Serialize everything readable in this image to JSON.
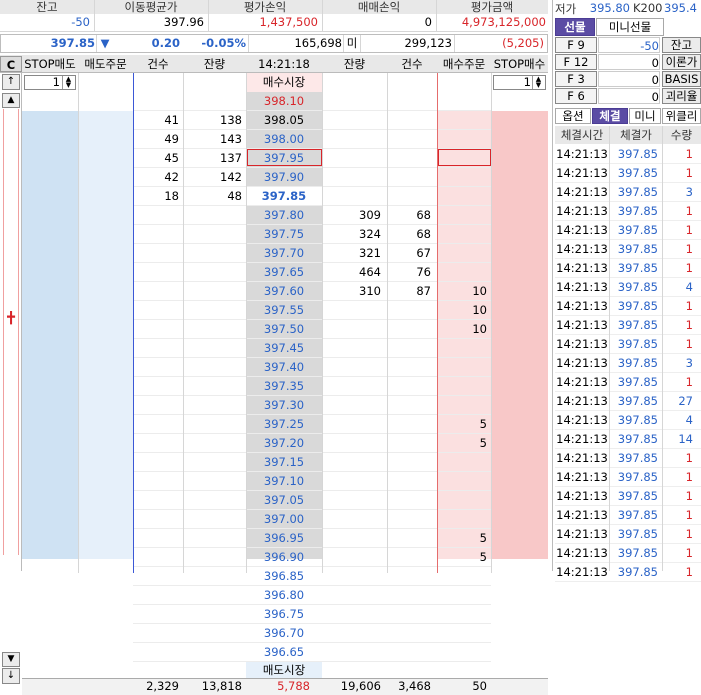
{
  "summary": {
    "headers": [
      "잔고",
      "이동평균가",
      "평가손익",
      "매매손익",
      "평가금액"
    ],
    "values": [
      "-50",
      "397.96",
      "1,437,500",
      "0",
      "4,973,125,000"
    ]
  },
  "quote": {
    "price": "397.85",
    "arrow": "▼",
    "change": "0.20",
    "rate": "-0.05%",
    "ask_total": "165,698",
    "label": "미",
    "bid_total": "299,123",
    "diff": "(5,205)"
  },
  "right_top": {
    "low_label": "저가",
    "low_value": "395.80",
    "k200_label": "K200",
    "k200_value": "395.4"
  },
  "tabs_top": [
    "선물",
    "미니선물"
  ],
  "fkeys": [
    {
      "key": "F 9",
      "value": "-50",
      "button": "잔고"
    },
    {
      "key": "F 12",
      "value": "0",
      "button": "이론가"
    },
    {
      "key": "F 3",
      "value": "0",
      "button": "BASIS"
    },
    {
      "key": "F 6",
      "value": "0",
      "button": "괴리율"
    }
  ],
  "tabs_bottom": [
    "옵션",
    "체결",
    "미니",
    "위클리"
  ],
  "ticks": {
    "headers": [
      "체결시간",
      "체결가",
      "수량"
    ],
    "rows": [
      {
        "time": "14:21:13",
        "price": "397.85",
        "qty": "1"
      },
      {
        "time": "14:21:13",
        "price": "397.85",
        "qty": "1"
      },
      {
        "time": "14:21:13",
        "price": "397.85",
        "qty": "3"
      },
      {
        "time": "14:21:13",
        "price": "397.85",
        "qty": "1"
      },
      {
        "time": "14:21:13",
        "price": "397.85",
        "qty": "1"
      },
      {
        "time": "14:21:13",
        "price": "397.85",
        "qty": "1"
      },
      {
        "time": "14:21:13",
        "price": "397.85",
        "qty": "1"
      },
      {
        "time": "14:21:13",
        "price": "397.85",
        "qty": "4"
      },
      {
        "time": "14:21:13",
        "price": "397.85",
        "qty": "1"
      },
      {
        "time": "14:21:13",
        "price": "397.85",
        "qty": "1"
      },
      {
        "time": "14:21:13",
        "price": "397.85",
        "qty": "1"
      },
      {
        "time": "14:21:13",
        "price": "397.85",
        "qty": "3"
      },
      {
        "time": "14:21:13",
        "price": "397.85",
        "qty": "1"
      },
      {
        "time": "14:21:13",
        "price": "397.85",
        "qty": "27"
      },
      {
        "time": "14:21:13",
        "price": "397.85",
        "qty": "4"
      },
      {
        "time": "14:21:13",
        "price": "397.85",
        "qty": "14"
      },
      {
        "time": "14:21:13",
        "price": "397.85",
        "qty": "1"
      },
      {
        "time": "14:21:13",
        "price": "397.85",
        "qty": "1"
      },
      {
        "time": "14:21:13",
        "price": "397.85",
        "qty": "1"
      },
      {
        "time": "14:21:13",
        "price": "397.85",
        "qty": "1"
      },
      {
        "time": "14:21:13",
        "price": "397.85",
        "qty": "1"
      },
      {
        "time": "14:21:13",
        "price": "397.85",
        "qty": "1"
      },
      {
        "time": "14:21:13",
        "price": "397.85",
        "qty": "1"
      }
    ]
  },
  "book": {
    "headers": [
      "C",
      "STOP매도",
      "매도주문",
      "건수",
      "잔량",
      "14:21:18",
      "잔량",
      "건수",
      "매수주문",
      "STOP매수"
    ],
    "stop_sell_qty": "1",
    "stop_buy_qty": "1",
    "market_sell": "매수시장",
    "market_buy": "매도시장",
    "rows": [
      {
        "price": "398.10",
        "c": "red",
        "ac": "",
        "aq": "",
        "bq": "",
        "bc": "",
        "bo": ""
      },
      {
        "price": "398.05",
        "c": "dk",
        "ac": "41",
        "aq": "138",
        "bq": "",
        "bc": "",
        "bo": ""
      },
      {
        "price": "398.00",
        "c": "blue",
        "ac": "49",
        "aq": "143",
        "bq": "",
        "bc": "",
        "bo": ""
      },
      {
        "price": "397.95",
        "c": "blue",
        "ac": "45",
        "aq": "137",
        "bq": "",
        "bc": "",
        "bo": ""
      },
      {
        "price": "397.90",
        "c": "blue",
        "ac": "42",
        "aq": "142",
        "bq": "",
        "bc": "",
        "bo": ""
      },
      {
        "price": "397.85",
        "c": "cur",
        "ac": "18",
        "aq": "48",
        "bq": "",
        "bc": "",
        "bo": ""
      },
      {
        "price": "397.80",
        "c": "blue",
        "ac": "",
        "aq": "",
        "bq": "309",
        "bc": "68",
        "bo": ""
      },
      {
        "price": "397.75",
        "c": "blue",
        "ac": "",
        "aq": "",
        "bq": "324",
        "bc": "68",
        "bo": ""
      },
      {
        "price": "397.70",
        "c": "blue",
        "ac": "",
        "aq": "",
        "bq": "321",
        "bc": "67",
        "bo": ""
      },
      {
        "price": "397.65",
        "c": "blue",
        "ac": "",
        "aq": "",
        "bq": "464",
        "bc": "76",
        "bo": ""
      },
      {
        "price": "397.60",
        "c": "blue",
        "ac": "",
        "aq": "",
        "bq": "310",
        "bc": "87",
        "bo": "10"
      },
      {
        "price": "397.55",
        "c": "blue",
        "ac": "",
        "aq": "",
        "bq": "",
        "bc": "",
        "bo": "10"
      },
      {
        "price": "397.50",
        "c": "blue",
        "ac": "",
        "aq": "",
        "bq": "",
        "bc": "",
        "bo": "10"
      },
      {
        "price": "397.45",
        "c": "blue",
        "ac": "",
        "aq": "",
        "bq": "",
        "bc": "",
        "bo": ""
      },
      {
        "price": "397.40",
        "c": "blue",
        "ac": "",
        "aq": "",
        "bq": "",
        "bc": "",
        "bo": ""
      },
      {
        "price": "397.35",
        "c": "blue",
        "ac": "",
        "aq": "",
        "bq": "",
        "bc": "",
        "bo": ""
      },
      {
        "price": "397.30",
        "c": "blue",
        "ac": "",
        "aq": "",
        "bq": "",
        "bc": "",
        "bo": ""
      },
      {
        "price": "397.25",
        "c": "blue",
        "ac": "",
        "aq": "",
        "bq": "",
        "bc": "",
        "bo": "5"
      },
      {
        "price": "397.20",
        "c": "blue",
        "ac": "",
        "aq": "",
        "bq": "",
        "bc": "",
        "bo": "5"
      },
      {
        "price": "397.15",
        "c": "blue",
        "ac": "",
        "aq": "",
        "bq": "",
        "bc": "",
        "bo": ""
      },
      {
        "price": "397.10",
        "c": "blue",
        "ac": "",
        "aq": "",
        "bq": "",
        "bc": "",
        "bo": ""
      },
      {
        "price": "397.05",
        "c": "blue",
        "ac": "",
        "aq": "",
        "bq": "",
        "bc": "",
        "bo": ""
      },
      {
        "price": "397.00",
        "c": "blue",
        "ac": "",
        "aq": "",
        "bq": "",
        "bc": "",
        "bo": ""
      },
      {
        "price": "396.95",
        "c": "blue",
        "ac": "",
        "aq": "",
        "bq": "",
        "bc": "",
        "bo": "5"
      },
      {
        "price": "396.90",
        "c": "blue",
        "ac": "",
        "aq": "",
        "bq": "",
        "bc": "",
        "bo": "5"
      },
      {
        "price": "396.85",
        "c": "blue",
        "ac": "",
        "aq": "",
        "bq": "",
        "bc": "",
        "bo": ""
      },
      {
        "price": "396.80",
        "c": "blue",
        "ac": "",
        "aq": "",
        "bq": "",
        "bc": "",
        "bo": ""
      },
      {
        "price": "396.75",
        "c": "blue",
        "ac": "",
        "aq": "",
        "bq": "",
        "bc": "",
        "bo": ""
      },
      {
        "price": "396.70",
        "c": "blue",
        "ac": "",
        "aq": "",
        "bq": "",
        "bc": "",
        "bo": ""
      },
      {
        "price": "396.65",
        "c": "blue",
        "ac": "",
        "aq": "",
        "bq": "",
        "bc": "",
        "bo": ""
      }
    ],
    "totals": {
      "ac": "2,329",
      "aq": "13,818",
      "diff": "5,788",
      "bq": "19,606",
      "bc": "3,468",
      "bo": "50"
    }
  },
  "colors": {
    "sell_bg": "#cfe2f3",
    "buy_bg": "#f8c8c8",
    "price_bg": "#d9d9d9",
    "accent": "#5b4ca4"
  }
}
